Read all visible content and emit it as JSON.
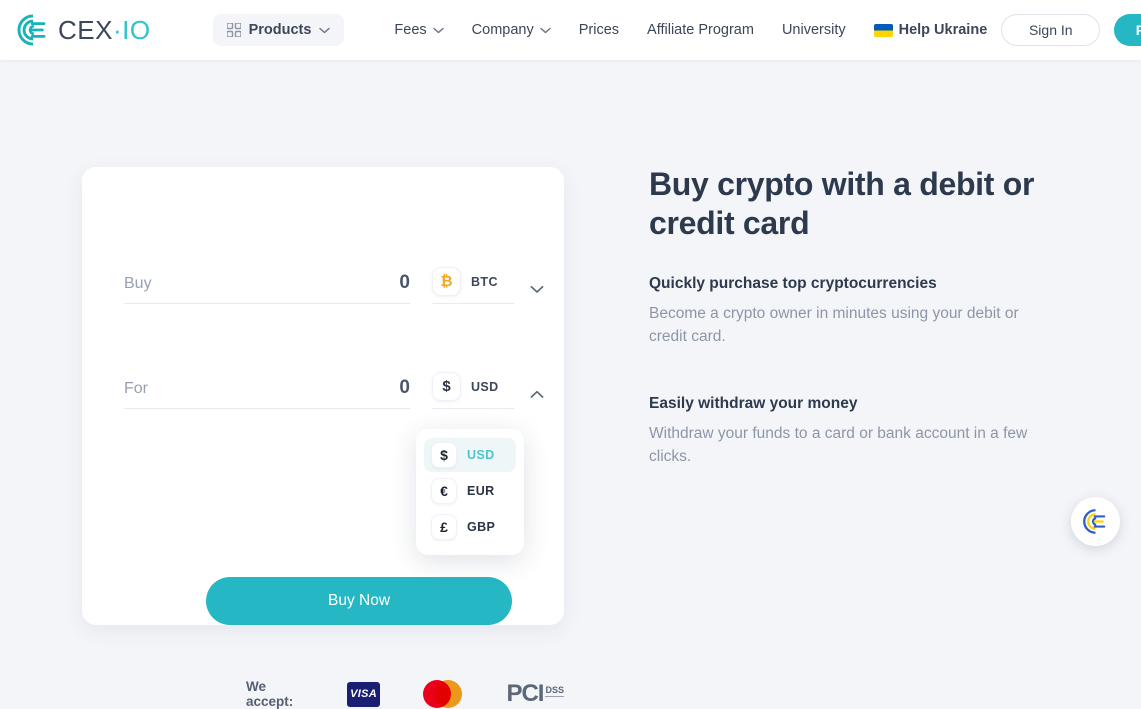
{
  "header": {
    "logo": {
      "name": "cexio-logo",
      "text_main": "CEX",
      "text_accent": "·IO"
    },
    "products_button": {
      "label": "Products",
      "icon": "grid-icon",
      "chevron": "chevron-down-icon"
    },
    "nav_items": [
      {
        "label": "Fees",
        "has_chevron": true
      },
      {
        "label": "Company",
        "has_chevron": true
      },
      {
        "label": "Prices",
        "has_chevron": false
      },
      {
        "label": "Affiliate Program",
        "has_chevron": false
      },
      {
        "label": "University",
        "has_chevron": false
      },
      {
        "label": "Help Ukraine",
        "has_chevron": false,
        "icon": "ukraine-flag-icon"
      }
    ],
    "sign_in_label": "Sign In",
    "register_label": "Register"
  },
  "widget": {
    "buy_row": {
      "placeholder": "Buy",
      "value": "0",
      "currency_code": "BTC",
      "currency_symbol": "₿",
      "chevron": "chevron-down-icon"
    },
    "for_row": {
      "placeholder": "For",
      "value": "0",
      "currency_code": "USD",
      "currency_symbol": "$",
      "chevron": "chevron-up-icon"
    },
    "dropdown": {
      "open": true,
      "options": [
        {
          "symbol": "$",
          "code": "USD",
          "selected": true
        },
        {
          "symbol": "€",
          "code": "EUR",
          "selected": false
        },
        {
          "symbol": "£",
          "code": "GBP",
          "selected": false
        }
      ]
    },
    "buy_button_label": "Buy Now",
    "accept": {
      "label": "We accept:",
      "visa_label": "VISA",
      "mastercard_name": "mastercard-logo",
      "pci_main": "PCI",
      "pci_sub": "DSS"
    }
  },
  "content": {
    "heading": "Buy crypto with a debit or credit card",
    "features": [
      {
        "title": "Quickly purchase top cryptocurrencies",
        "body": "Become a crypto owner in minutes using your debit or credit card."
      },
      {
        "title": "Easily withdraw your money",
        "body": "Withdraw your funds to a card or bank account in a few clicks."
      }
    ]
  },
  "fab": {
    "name": "support-chat-button"
  },
  "colors": {
    "accent_teal": "#25b7c4",
    "page_bg": "#f4f5f9",
    "heading": "#2d3a4d",
    "muted_text": "#8d96a6",
    "btc_gold": "#f5a623",
    "visa_navy": "#1a1f71",
    "mc_red": "#eb001b",
    "mc_orange": "#f79e1b"
  }
}
